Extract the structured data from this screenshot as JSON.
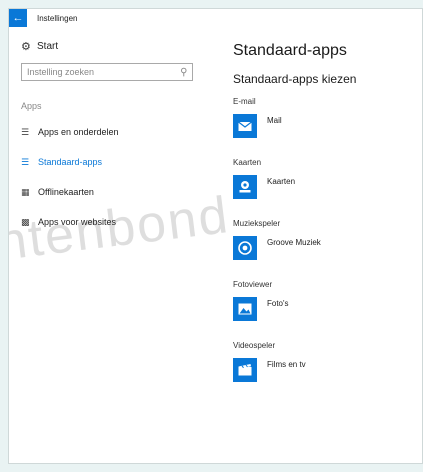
{
  "window": {
    "title": "Instellingen",
    "back_icon": "back-arrow-icon"
  },
  "sidebar": {
    "start_label": "Start",
    "search_placeholder": "Instelling zoeken",
    "section_label": "Apps",
    "items": [
      {
        "label": "Apps en onderdelen",
        "icon": "apps-list-icon",
        "active": false
      },
      {
        "label": "Standaard-apps",
        "icon": "default-apps-icon",
        "active": true
      },
      {
        "label": "Offlinekaarten",
        "icon": "offline-maps-icon",
        "active": false
      },
      {
        "label": "Apps voor websites",
        "icon": "apps-for-websites-icon",
        "active": false
      }
    ]
  },
  "main": {
    "title": "Standaard-apps",
    "subtitle": "Standaard-apps kiezen",
    "categories": [
      {
        "label": "E-mail",
        "app": "Mail",
        "icon": "mail-icon"
      },
      {
        "label": "Kaarten",
        "app": "Kaarten",
        "icon": "maps-icon"
      },
      {
        "label": "Muziekspeler",
        "app": "Groove Muziek",
        "icon": "groove-music-icon"
      },
      {
        "label": "Fotoviewer",
        "app": "Foto's",
        "icon": "photos-icon"
      },
      {
        "label": "Videospeler",
        "app": "Films en tv",
        "icon": "films-tv-icon"
      }
    ]
  },
  "watermark": "ntenbond",
  "colors": {
    "accent": "#0a78d7",
    "background": "#e9f3f3",
    "window": "#ffffff"
  }
}
